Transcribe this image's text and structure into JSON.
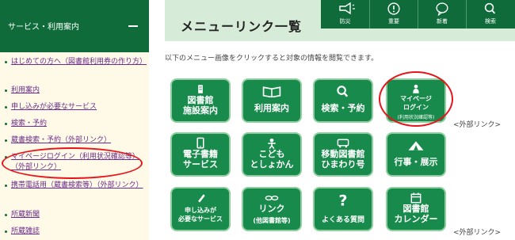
{
  "sidebar": {
    "title": "サービス・利用案内",
    "items": [
      {
        "label": "はじめての方へ（図書館利用券の作り方）"
      },
      {
        "label": "利用案内"
      },
      {
        "label": "申し込みが必要なサービス"
      },
      {
        "label": "検索・予約"
      },
      {
        "label": "蔵書検索・予約（外部リンク）"
      },
      {
        "label": "マイページログイン（利用状況確認等）（外部リンク）"
      },
      {
        "label": "携帯電話用（蔵書検索等）（外部リンク）"
      },
      {
        "label": "所蔵新聞"
      },
      {
        "label": "所蔵雑誌"
      }
    ]
  },
  "header": {
    "title": "メニューリンク一覧"
  },
  "topnav": [
    {
      "label": "防災",
      "icon": "megaphone-icon"
    },
    {
      "label": "重要",
      "icon": "exclamation-icon"
    },
    {
      "label": "新着",
      "icon": "speech-bubble-icon"
    },
    {
      "label": "検索",
      "icon": "search-icon"
    }
  ],
  "intro": "以下のメニュー画像をクリックすると対象の情報を閲覧できます。",
  "tiles": [
    {
      "line1": "図書館",
      "line2": "施設案内",
      "icon": "building-icon"
    },
    {
      "line1": "利用案内",
      "line2": "",
      "icon": "book-icon"
    },
    {
      "line1": "検索・予約",
      "line2": "",
      "icon": "search-icon"
    },
    {
      "line1": "マイページ",
      "line2": "ログイン",
      "line3": "(利用状況確認等)",
      "icon": "person-icon"
    },
    {
      "line1": "電子書籍",
      "line2": "サービス",
      "icon": "tablet-icon"
    },
    {
      "line1": "こども",
      "line2": "としょかん",
      "icon": "child-icon"
    },
    {
      "line1": "移動図書館",
      "line2": "ひまわり号",
      "icon": "bus-icon"
    },
    {
      "line1": "行事・展示",
      "line2": "",
      "icon": "tent-icon"
    },
    {
      "line1": "申し込みが",
      "line2": "必要なサービス",
      "icon": "pen-icon"
    },
    {
      "line1": "リンク",
      "line2": "(他図書館等)",
      "icon": "chain-icon"
    },
    {
      "line1": "よくある質問",
      "line2": "",
      "icon": "question-icon"
    },
    {
      "line1": "図書館",
      "line2": "カレンダー",
      "icon": "calendar-icon"
    }
  ],
  "external_link_label": "<外部リンク>",
  "colors": {
    "brand_green": "#0f6c3a",
    "tile_green": "#188a4c",
    "header_bg": "#d7ecd8",
    "sidebar_bg": "#fffae8",
    "highlight_red": "#e8141b",
    "link_purple": "#6a2d8a"
  }
}
